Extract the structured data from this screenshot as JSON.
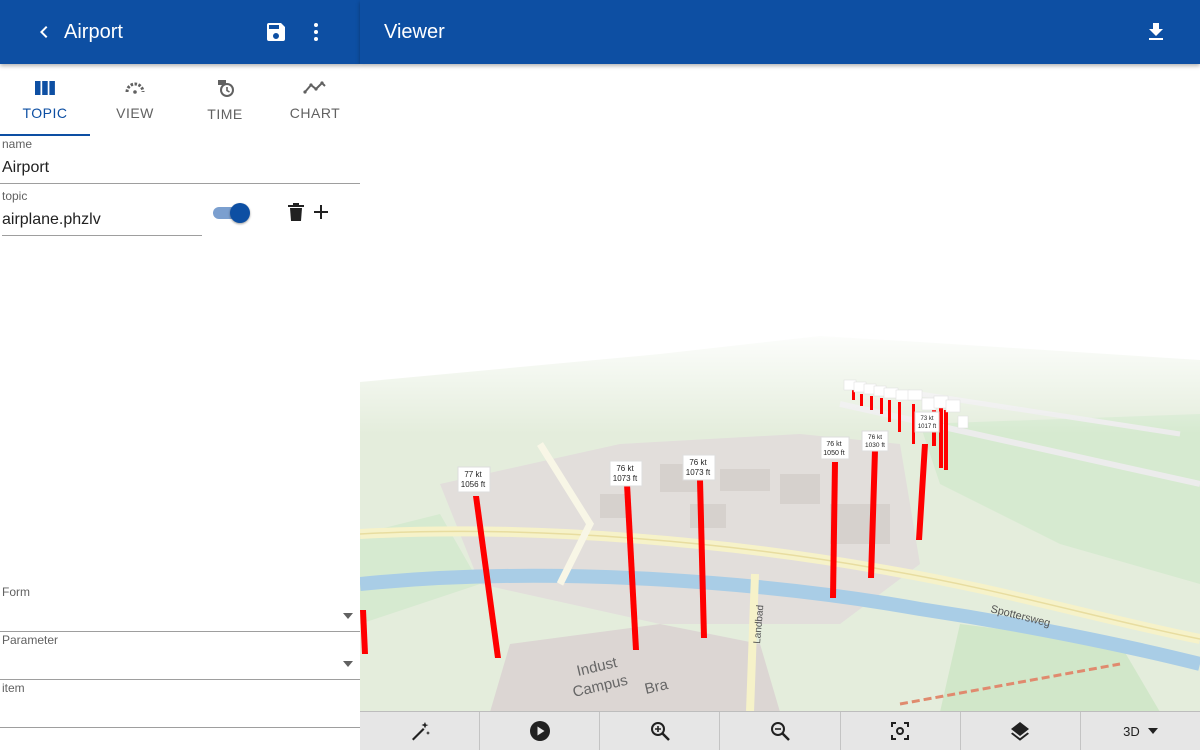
{
  "left_panel": {
    "title": "Airport",
    "tabs": [
      {
        "label": "TOPIC",
        "icon": "columns-icon"
      },
      {
        "label": "VIEW",
        "icon": "gauge-icon"
      },
      {
        "label": "TIME",
        "icon": "history-icon"
      },
      {
        "label": "CHART",
        "icon": "line-chart-icon"
      }
    ],
    "name_label": "name",
    "name_value": "Airport",
    "topic_label": "topic",
    "topic_value": "airplane.phzlv",
    "topic_toggle_on": true,
    "form_label": "Form",
    "parameter_label": "Parameter",
    "item_label": "item"
  },
  "viewer": {
    "title": "Viewer",
    "street_labels": [
      "Spottersweg",
      "Landbad",
      "Campus",
      "Indust",
      "Bra"
    ],
    "markers": [
      {
        "speed": "77 kt",
        "alt": "1056 ft"
      },
      {
        "speed": "76 kt",
        "alt": "1073 ft"
      },
      {
        "speed": "76 kt",
        "alt": "1073 ft"
      },
      {
        "speed": "76 kt",
        "alt": "1050 ft"
      },
      {
        "speed": "76 kt",
        "alt": "1030 ft"
      },
      {
        "speed": "73 kt",
        "alt": "1017 ft"
      }
    ],
    "toolbar": {
      "mode": "3D"
    },
    "colors": {
      "accent": "#0d4fa3",
      "pin": "#ff0000",
      "water": "#a9cde6",
      "green": "#d6ead0"
    }
  }
}
